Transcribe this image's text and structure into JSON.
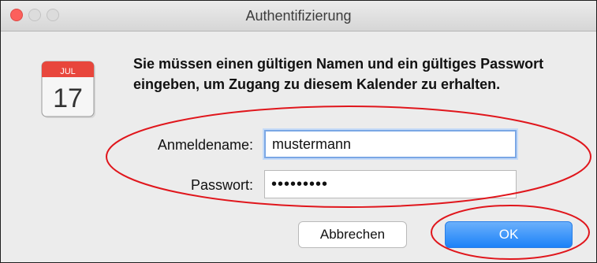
{
  "window": {
    "title": "Authentifizierung"
  },
  "icon": {
    "name": "calendar-icon",
    "month": "JUL",
    "day": "17"
  },
  "message": "Sie müssen einen gültigen Namen und ein gültiges Passwort eingeben, um Zugang zu diesem Kalender zu erhalten.",
  "form": {
    "username_label": "Anmeldename:",
    "username_value": "mustermann",
    "password_label": "Passwort:",
    "password_value": "•••••••••"
  },
  "buttons": {
    "cancel": "Abbrechen",
    "ok": "OK"
  },
  "colors": {
    "annotation": "#e0161c",
    "close_light": "#fc605c",
    "ok_accent": "#1c82f8"
  }
}
